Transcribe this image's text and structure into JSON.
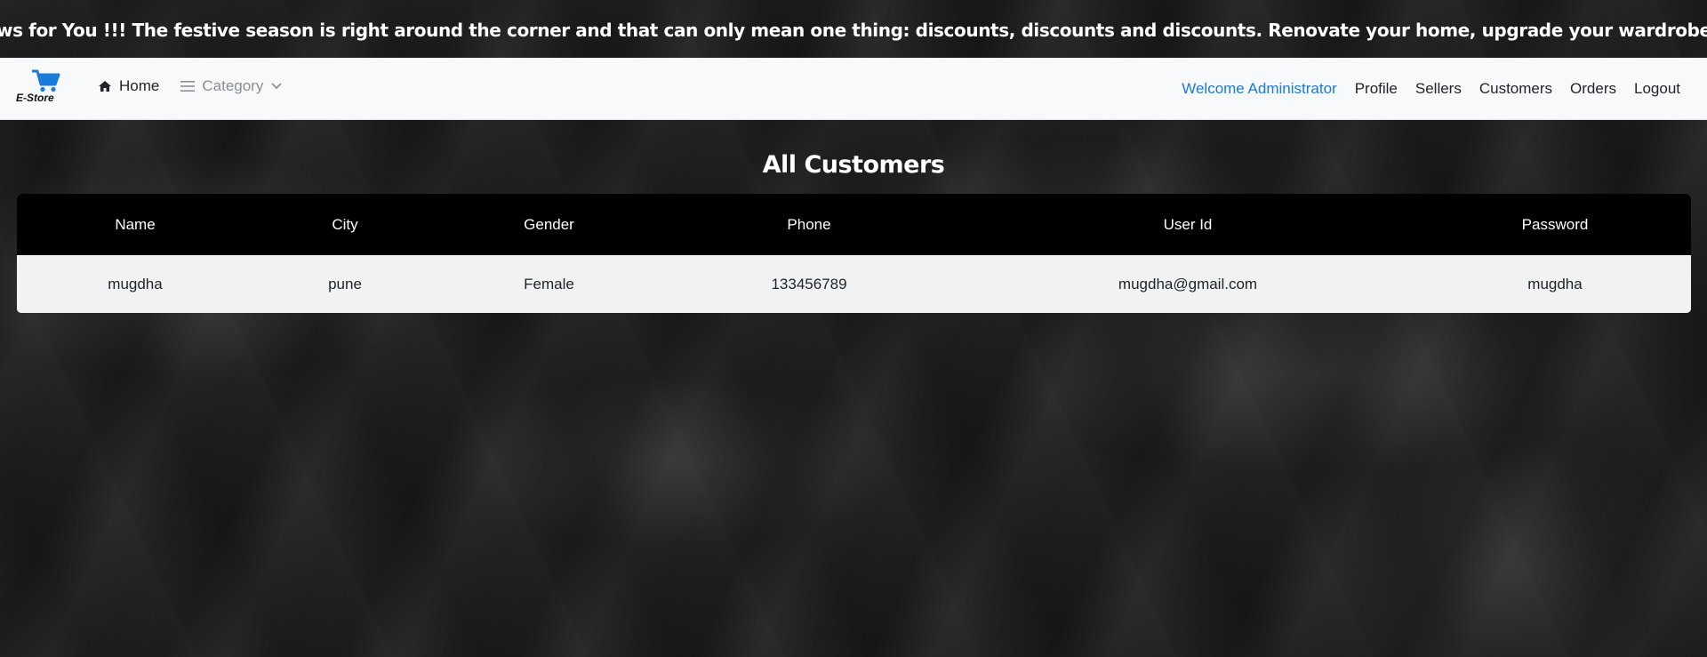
{
  "marquee": {
    "text": "ws for You !!! The festive season is right around the corner and that can only mean one thing: discounts, discounts and discounts. Renovate your home, upgrade your wardrobe or gift a loved"
  },
  "brand": {
    "label": "E-Store",
    "icon": "shopping-cart-icon",
    "color": "#1a7ad9"
  },
  "nav": {
    "home_label": "Home",
    "category_label": "Category",
    "welcome_label": "Welcome Administrator",
    "links": {
      "profile": "Profile",
      "sellers": "Sellers",
      "customers": "Customers",
      "orders": "Orders",
      "logout": "Logout"
    }
  },
  "page": {
    "title": "All Customers"
  },
  "table": {
    "headers": {
      "name": "Name",
      "city": "City",
      "gender": "Gender",
      "phone": "Phone",
      "user_id": "User Id",
      "password": "Password"
    },
    "rows": [
      {
        "name": "mugdha",
        "city": "pune",
        "gender": "Female",
        "phone": "133456789",
        "user_id": "mugdha@gmail.com",
        "password": "mugdha"
      }
    ]
  }
}
